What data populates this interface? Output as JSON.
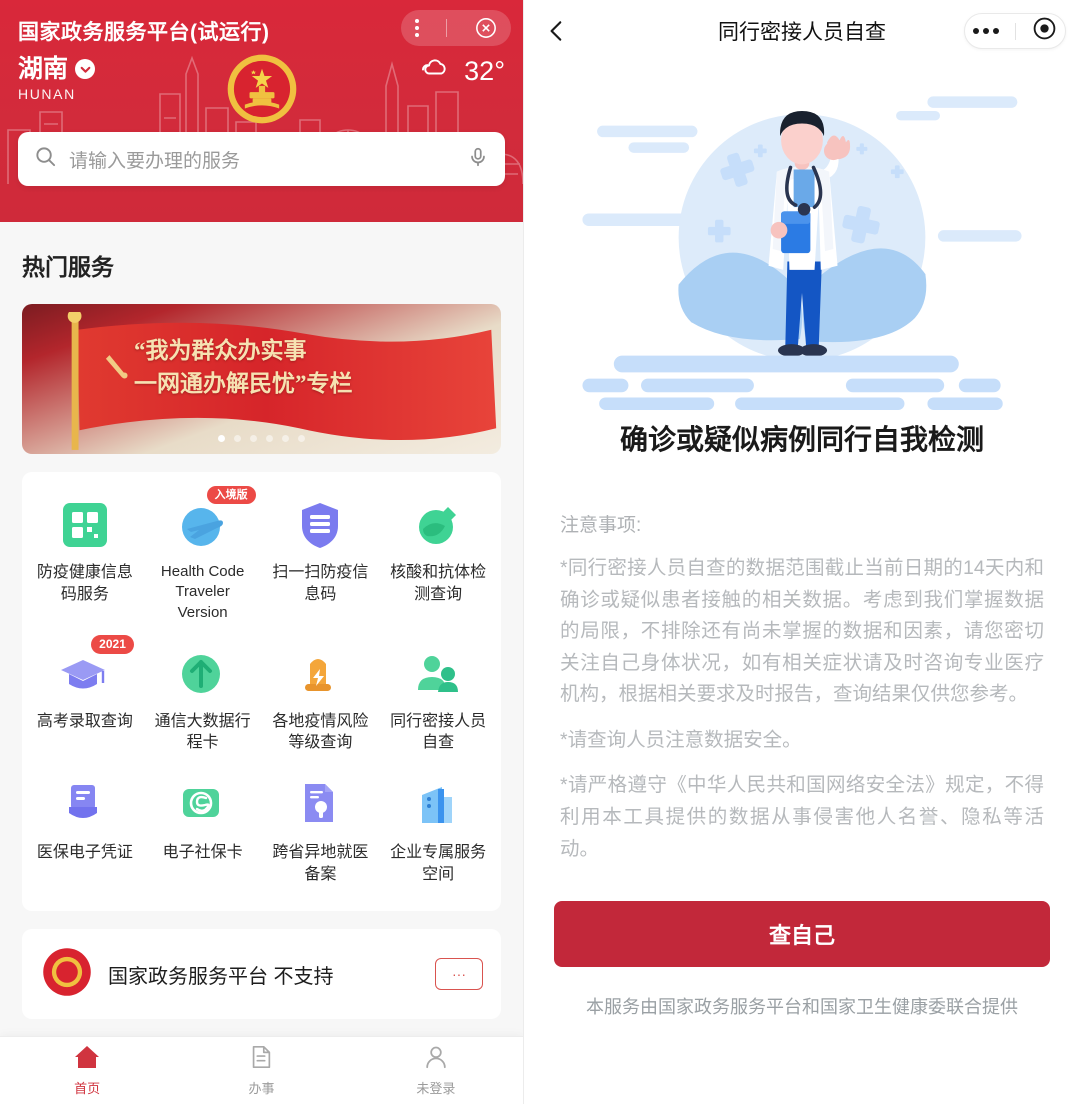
{
  "left": {
    "header": {
      "app_title": "国家政务服务平台(试运行)",
      "menu_icon": "more-vertical-icon",
      "close_icon": "close-circle-icon",
      "region_name": "湖南",
      "region_chevron_icon": "chevron-down-icon",
      "region_en": "HUNAN",
      "emblem_icon": "national-emblem-icon",
      "weather_icon": "cloudy-icon",
      "temperature": "32°",
      "search_icon": "search-icon",
      "search_placeholder": "请输入要办理的服务",
      "mic_icon": "microphone-icon",
      "brand_red": "#d22b3b"
    },
    "hot_services": {
      "section_title": "热门服务",
      "banner": {
        "line1": "“我为群众办实事",
        "line2": "一网通办解民忧”专栏",
        "emblem_icon": "hammer-sickle-icon",
        "dots_total": 6,
        "dots_active_index": 0
      },
      "tiles": [
        {
          "label": "防疫健康信息码服务",
          "icon": "health-code-grid-icon",
          "color": "#3fd394",
          "badge": null,
          "lang": "zh"
        },
        {
          "label": "Health Code Traveler Version",
          "icon": "airplane-icon",
          "color": "#57b5ec",
          "badge": "入境版",
          "lang": "en"
        },
        {
          "label": "扫一扫防疫信息码",
          "icon": "shield-scan-icon",
          "color": "#7b7bef",
          "badge": null,
          "lang": "zh"
        },
        {
          "label": "核酸和抗体检测查询",
          "icon": "test-tube-icon",
          "color": "#3fd394",
          "badge": null,
          "lang": "zh"
        },
        {
          "label": "高考录取查询",
          "icon": "graduation-cap-icon",
          "color": "#8a8af0",
          "badge": "2021",
          "lang": "zh"
        },
        {
          "label": "通信大数据行程卡",
          "icon": "arrow-up-circle-icon",
          "color": "#4fd39a",
          "badge": null,
          "lang": "zh"
        },
        {
          "label": "各地疫情风险等级查询",
          "icon": "alarm-light-icon",
          "color": "#f4a63a",
          "badge": null,
          "lang": "zh"
        },
        {
          "label": "同行密接人员自查",
          "icon": "two-people-icon",
          "color": "#4fd39a",
          "badge": null,
          "lang": "zh"
        },
        {
          "label": "医保电子凭证",
          "icon": "medical-card-icon",
          "color": "#7b7bef",
          "badge": null,
          "lang": "zh"
        },
        {
          "label": "电子社保卡",
          "icon": "social-security-card-icon",
          "color": "#4fd39a",
          "badge": null,
          "lang": "zh"
        },
        {
          "label": "跨省异地就医备案",
          "icon": "document-lock-icon",
          "color": "#7b7bef",
          "badge": null,
          "lang": "zh"
        },
        {
          "label": "企业专属服务空间",
          "icon": "building-icon",
          "color": "#5bb4f2",
          "badge": null,
          "lang": "zh"
        }
      ]
    },
    "bottom_card": {
      "emblem_icon": "national-emblem-icon",
      "text": "国家政务服务平台 不支持",
      "button_label": "···"
    },
    "tabbar": [
      {
        "label": "首页",
        "icon": "home-icon",
        "active": true
      },
      {
        "label": "办事",
        "icon": "document-icon",
        "active": false
      },
      {
        "label": "未登录",
        "icon": "person-icon",
        "active": false
      }
    ]
  },
  "right": {
    "header": {
      "back_icon": "chevron-left-icon",
      "title": "同行密接人员自查",
      "more_icon": "more-horizontal-icon",
      "target_icon": "target-circle-icon"
    },
    "hero_illustration": "doctor-waving-illustration",
    "heading": "确诊或疑似病例同行自我检测",
    "note_title": "注意事项:",
    "notes": [
      "*同行密接人员自查的数据范围截止当前日期的14天内和确诊或疑似患者接触的相关数据。考虑到我们掌握数据的局限，不排除还有尚未掌握的数据和因素，请您密切关注自己身体状况，如有相关症状请及时咨询专业医疗机构，根据相关要求及时报告，查询结果仅供您参考。",
      "*请查询人员注意数据安全。",
      "*请严格遵守《中华人民共和国网络安全法》规定，不得利用本工具提供的数据从事侵害他人名誉、隐私等活动。"
    ],
    "primary_button": "查自己",
    "footer": "本服务由国家政务服务平台和国家卫生健康委联合提供",
    "accent_red": "#c2283a"
  }
}
